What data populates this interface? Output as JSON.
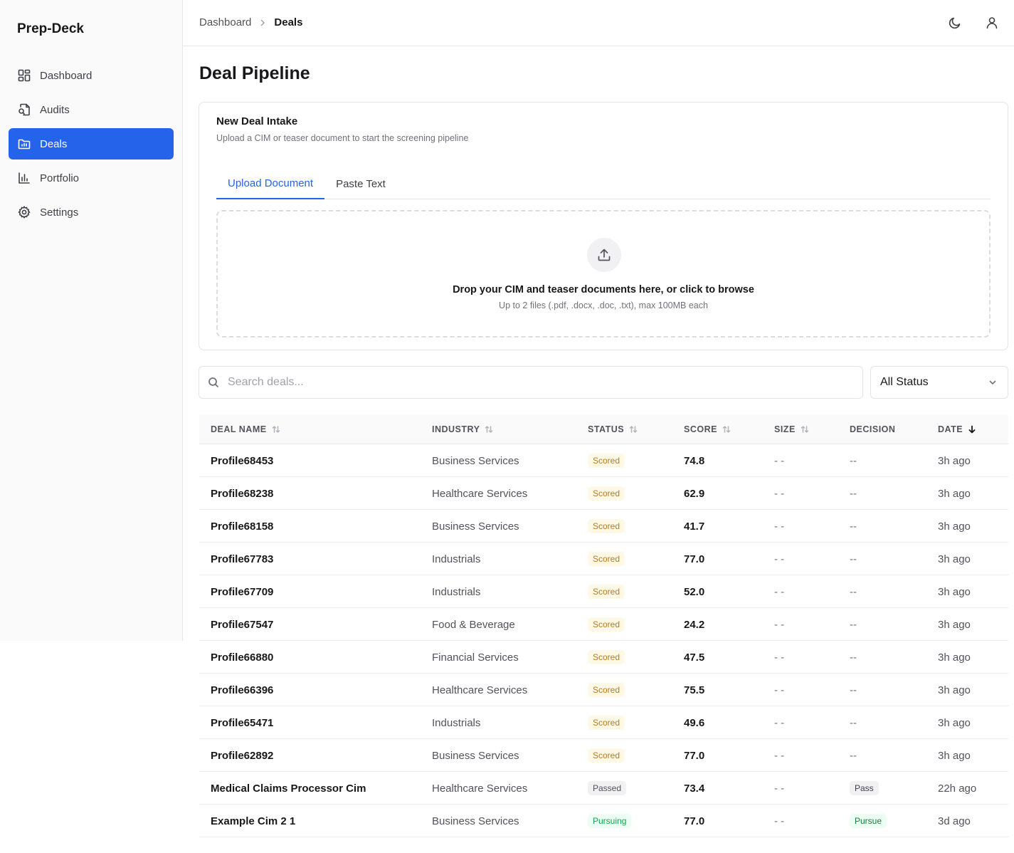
{
  "app": {
    "name": "Prep-Deck"
  },
  "sidebar": {
    "items": [
      {
        "label": "Dashboard",
        "icon": "dashboard-icon"
      },
      {
        "label": "Audits",
        "icon": "audit-icon"
      },
      {
        "label": "Deals",
        "icon": "folder-icon",
        "active": true
      },
      {
        "label": "Portfolio",
        "icon": "bar-chart-icon"
      },
      {
        "label": "Settings",
        "icon": "gear-icon"
      }
    ]
  },
  "header": {
    "breadcrumb": [
      "Dashboard",
      "Deals"
    ],
    "theme_icon": "moon-icon",
    "user_icon": "user-icon"
  },
  "page": {
    "title": "Deal Pipeline"
  },
  "intake": {
    "title": "New Deal Intake",
    "subtitle": "Upload a CIM or teaser document to start the screening pipeline",
    "tabs": [
      "Upload Document",
      "Paste Text"
    ],
    "active_tab": "Upload Document",
    "drop_title": "Drop your CIM and teaser documents here, or click to browse",
    "drop_sub": "Up to 2 files (.pdf, .docx, .doc, .txt), max 100MB each"
  },
  "search": {
    "placeholder": "Search deals...",
    "value": ""
  },
  "filter": {
    "selected": "All Status"
  },
  "table": {
    "columns": [
      "DEAL NAME",
      "INDUSTRY",
      "STATUS",
      "SCORE",
      "SIZE",
      "DECISION",
      "DATE"
    ],
    "rows": [
      {
        "name": "Profile68453",
        "industry": "Business Services",
        "status": "Scored",
        "score": "74.8",
        "size": "- -",
        "decision": "--",
        "date": "3h ago"
      },
      {
        "name": "Profile68238",
        "industry": "Healthcare Services",
        "status": "Scored",
        "score": "62.9",
        "size": "- -",
        "decision": "--",
        "date": "3h ago"
      },
      {
        "name": "Profile68158",
        "industry": "Business Services",
        "status": "Scored",
        "score": "41.7",
        "size": "- -",
        "decision": "--",
        "date": "3h ago"
      },
      {
        "name": "Profile67783",
        "industry": "Industrials",
        "status": "Scored",
        "score": "77.0",
        "size": "- -",
        "decision": "--",
        "date": "3h ago"
      },
      {
        "name": "Profile67709",
        "industry": "Industrials",
        "status": "Scored",
        "score": "52.0",
        "size": "- -",
        "decision": "--",
        "date": "3h ago"
      },
      {
        "name": "Profile67547",
        "industry": "Food & Beverage",
        "status": "Scored",
        "score": "24.2",
        "size": "- -",
        "decision": "--",
        "date": "3h ago"
      },
      {
        "name": "Profile66880",
        "industry": "Financial Services",
        "status": "Scored",
        "score": "47.5",
        "size": "- -",
        "decision": "--",
        "date": "3h ago"
      },
      {
        "name": "Profile66396",
        "industry": "Healthcare Services",
        "status": "Scored",
        "score": "75.5",
        "size": "- -",
        "decision": "--",
        "date": "3h ago"
      },
      {
        "name": "Profile65471",
        "industry": "Industrials",
        "status": "Scored",
        "score": "49.6",
        "size": "- -",
        "decision": "--",
        "date": "3h ago"
      },
      {
        "name": "Profile62892",
        "industry": "Business Services",
        "status": "Scored",
        "score": "77.0",
        "size": "- -",
        "decision": "--",
        "date": "3h ago"
      },
      {
        "name": "Medical Claims Processor Cim",
        "industry": "Healthcare Services",
        "status": "Passed",
        "score": "73.4",
        "size": "- -",
        "decision": "Pass",
        "date": "22h ago"
      },
      {
        "name": "Example Cim 2 1",
        "industry": "Business Services",
        "status": "Pursuing",
        "score": "77.0",
        "size": "- -",
        "decision": "Pursue",
        "date": "3d ago"
      }
    ]
  },
  "colors": {
    "accent": "#2563eb",
    "scored": "#b7791f",
    "pursuing": "#16a34a"
  }
}
